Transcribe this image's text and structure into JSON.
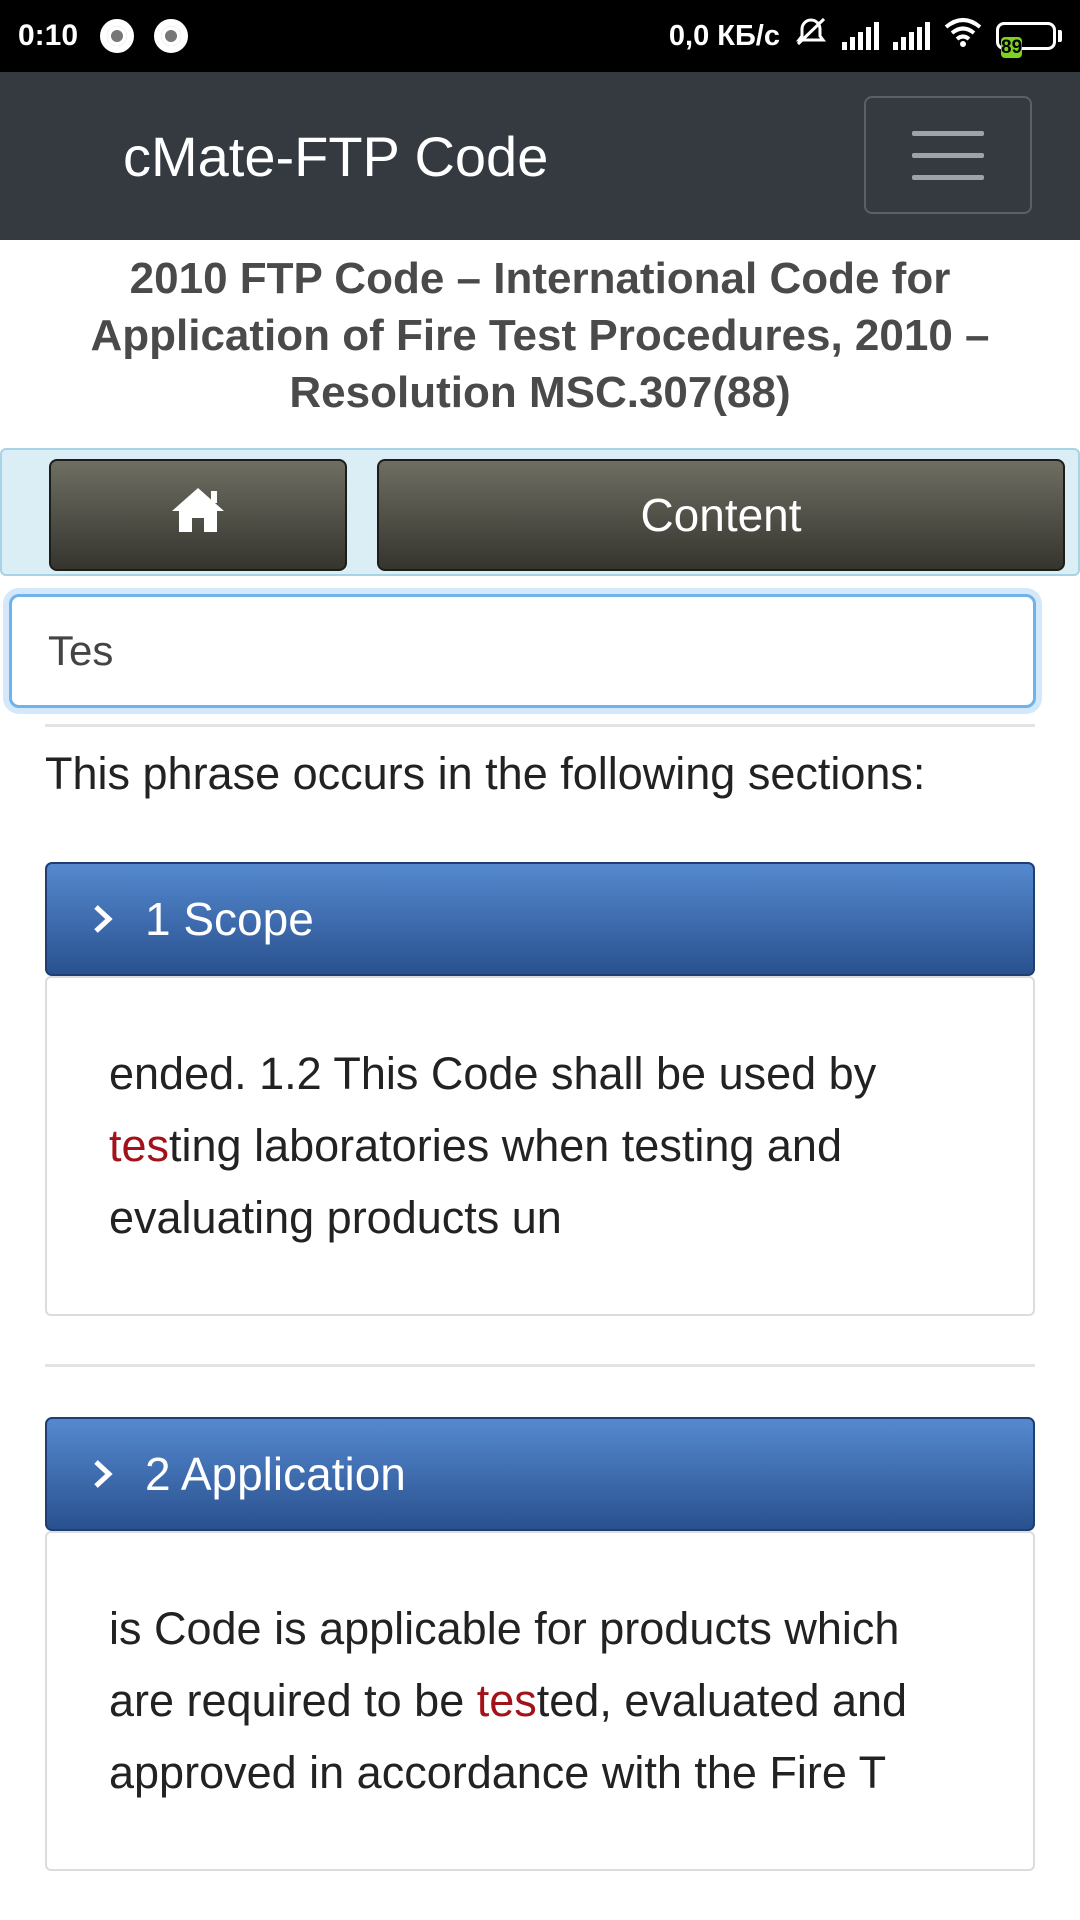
{
  "status_bar": {
    "time": "0:10",
    "speed": "0,0 КБ/с",
    "battery": "89"
  },
  "header": {
    "title": "cMate-FTP Code"
  },
  "document": {
    "title": "2010 FTP Code – International Code for Application of Fire Test Procedures, 2010 – Resolution MSC.307(88)"
  },
  "nav": {
    "home_icon": "home-icon",
    "content_label": "Content"
  },
  "search": {
    "value": "Tes"
  },
  "results": {
    "lead": "This phrase occurs in the following sections:",
    "items": [
      {
        "title": "1 Scope",
        "snippet_before": "ended. 1.2 This Code shall be used by ",
        "snippet_match": "tes",
        "snippet_after": "ting laboratories when testing and evaluating products un"
      },
      {
        "title": "2 Application",
        "snippet_before": "is Code is applicable for products which are required to be ",
        "snippet_match": "tes",
        "snippet_after": "ted, evaluated and approved in accordance with the Fire T"
      }
    ]
  },
  "colors": {
    "header_bg": "#343a40",
    "result_header": "#3a6ab0",
    "highlight": "#a3121a",
    "nav_bar_bg": "#dbeef5"
  }
}
